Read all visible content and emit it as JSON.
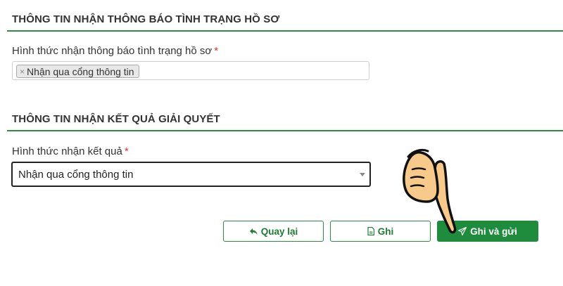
{
  "section1": {
    "title": "THÔNG TIN NHẬN THÔNG BÁO TÌNH TRẠNG HỒ SƠ",
    "field_label": "Hình thức nhận thông báo tình trạng hồ sơ",
    "required_mark": "*",
    "tag_remove": "×",
    "selected_tags": [
      "Nhận qua cổng thông tin"
    ]
  },
  "section2": {
    "title": "THÔNG TIN NHẬN KẾT QUẢ GIẢI QUYẾT",
    "field_label": "Hình thức nhận kết quả",
    "required_mark": "*",
    "selected_value": "Nhận qua cổng thông tin"
  },
  "actions": {
    "back_label": "Quay lại",
    "save_label": "Ghi",
    "save_send_label": "Ghi và gửi"
  },
  "colors": {
    "accent": "#1e8b3d",
    "required": "#d9302f"
  },
  "icons": {
    "back": "back-arrow-icon",
    "save": "document-icon",
    "send": "paper-plane-icon",
    "pointer": "pointing-hand-icon"
  }
}
